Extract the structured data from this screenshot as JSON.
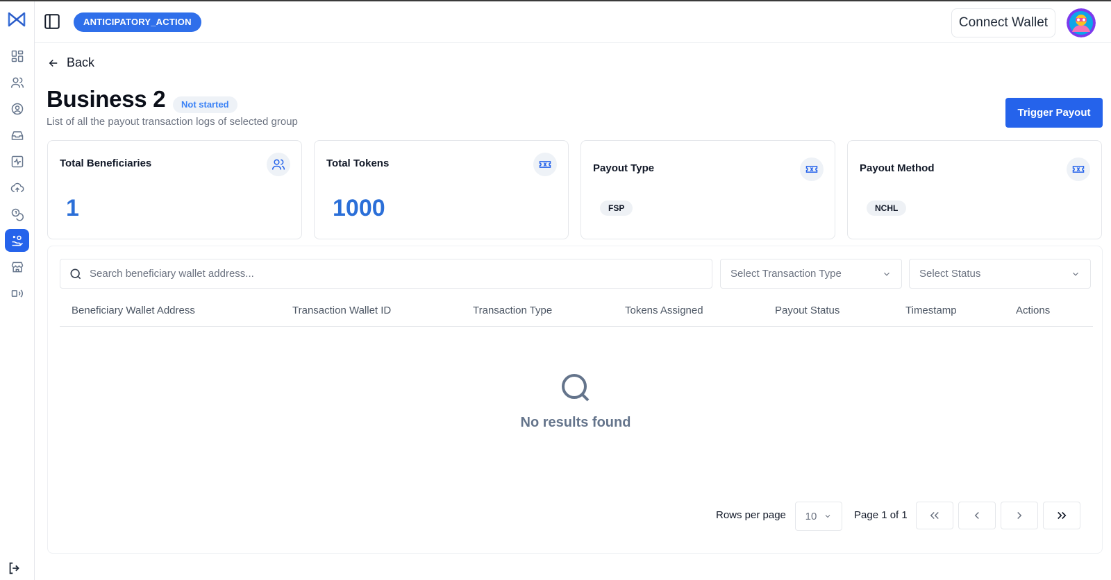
{
  "header": {
    "project_badge": "ANTICIPATORY_ACTION",
    "connect_wallet_label": "Connect Wallet"
  },
  "sidebar": {
    "items": [
      {
        "icon": "dashboard-icon"
      },
      {
        "icon": "users-icon"
      },
      {
        "icon": "user-circle-icon"
      },
      {
        "icon": "inbox-icon"
      },
      {
        "icon": "activity-icon"
      },
      {
        "icon": "cloud-upload-icon"
      },
      {
        "icon": "coins-icon"
      },
      {
        "icon": "hand-coins-icon",
        "active": true
      },
      {
        "icon": "store-icon"
      },
      {
        "icon": "broadcast-icon"
      }
    ],
    "logout_icon": "logout-icon"
  },
  "page": {
    "back_label": "Back",
    "title": "Business 2",
    "status": "Not started",
    "subtitle": "List of all the payout transaction logs of selected group",
    "trigger_payout_label": "Trigger Payout"
  },
  "cards": [
    {
      "title": "Total Beneficiaries",
      "value": "1",
      "icon": "users-icon"
    },
    {
      "title": "Total Tokens",
      "value": "1000",
      "icon": "ticket-icon"
    },
    {
      "title": "Payout Type",
      "value": "FSP",
      "icon": "ticket-icon"
    },
    {
      "title": "Payout Method",
      "value": "NCHL",
      "icon": "ticket-icon"
    }
  ],
  "filters": {
    "search_placeholder": "Search beneficiary wallet address...",
    "transaction_type_placeholder": "Select Transaction Type",
    "status_placeholder": "Select Status"
  },
  "table": {
    "columns": [
      "Beneficiary Wallet Address",
      "Transaction Wallet ID",
      "Transaction Type",
      "Tokens Assigned",
      "Payout Status",
      "Timestamp",
      "Actions"
    ],
    "rows": [],
    "empty_text": "No results found"
  },
  "pagination": {
    "rows_per_page_label": "Rows per page",
    "rows_per_page_value": "10",
    "page_info": "Page 1 of 1"
  },
  "colors": {
    "accent": "#2563eb",
    "value_blue": "#2b6fd8"
  }
}
